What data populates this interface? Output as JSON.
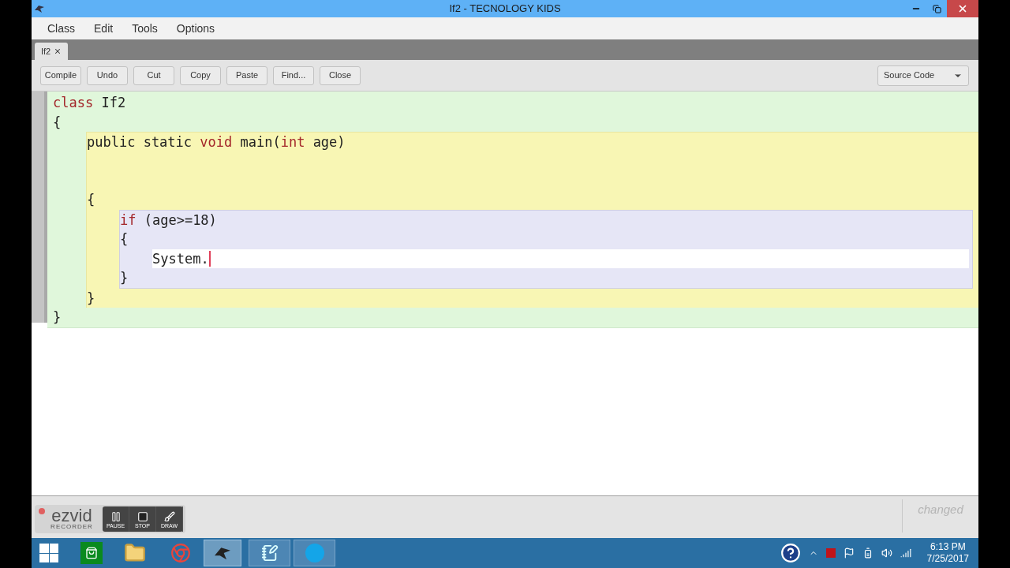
{
  "window": {
    "title": "If2 - TECNOLOGY KIDS"
  },
  "menu": [
    "Class",
    "Edit",
    "Tools",
    "Options"
  ],
  "tabs": [
    {
      "label": "If2",
      "selected": true
    }
  ],
  "toolbar": {
    "buttons": [
      "Compile",
      "Undo",
      "Cut",
      "Copy",
      "Paste",
      "Find...",
      "Close"
    ],
    "view_select": "Source Code"
  },
  "editor": {
    "class_block": {
      "header": [
        {
          "text": "class",
          "kind": "keyword"
        },
        {
          "text": " If2",
          "kind": "plain"
        }
      ],
      "open": "{",
      "close": "}",
      "method_block": {
        "header": [
          {
            "text": "public static ",
            "kind": "plain"
          },
          {
            "text": "void",
            "kind": "keyword"
          },
          {
            "text": " main(",
            "kind": "plain"
          },
          {
            "text": "int",
            "kind": "keyword"
          },
          {
            "text": " age)",
            "kind": "plain"
          }
        ],
        "open": "{",
        "close": "}",
        "if_block": {
          "header": [
            {
              "text": "if",
              "kind": "keyword"
            },
            {
              "text": " (age>=18)",
              "kind": "plain"
            }
          ],
          "open": "{",
          "close": "}",
          "statement": "System."
        }
      }
    }
  },
  "status": "changed",
  "recorder": {
    "brand": "ezvid",
    "subtitle": "RECORDER",
    "buttons": [
      "PAUSE",
      "STOP",
      "DRAW"
    ]
  },
  "taskbar": {
    "time": "6:13 PM",
    "date": "7/25/2017"
  }
}
